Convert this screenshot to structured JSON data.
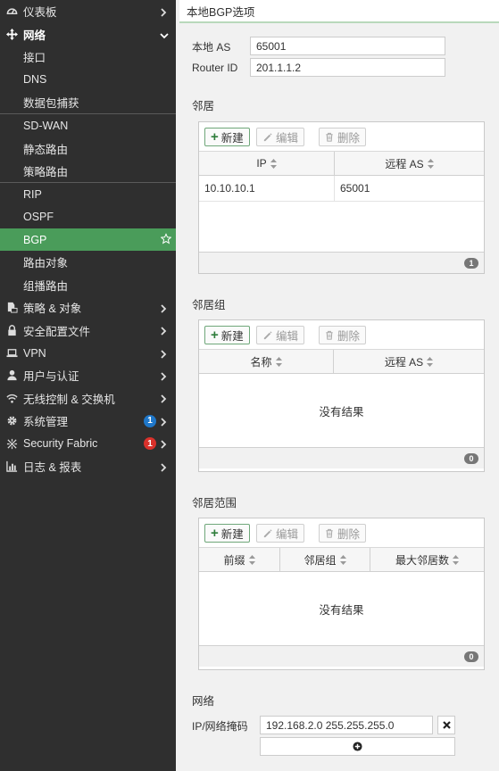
{
  "sidebar": {
    "items": [
      {
        "label": "仪表板",
        "icon": "dashboard-icon",
        "type": "top"
      },
      {
        "label": "网络",
        "icon": "network-icon",
        "type": "top-open"
      },
      {
        "label": "接口",
        "type": "sub"
      },
      {
        "label": "DNS",
        "type": "sub"
      },
      {
        "label": "数据包捕获",
        "type": "sub"
      },
      {
        "label": "SD-WAN",
        "type": "sub"
      },
      {
        "label": "静态路由",
        "type": "sub"
      },
      {
        "label": "策略路由",
        "type": "sub"
      },
      {
        "label": "RIP",
        "type": "sub"
      },
      {
        "label": "OSPF",
        "type": "sub"
      },
      {
        "label": "BGP",
        "type": "active"
      },
      {
        "label": "路由对象",
        "type": "sub"
      },
      {
        "label": "组播路由",
        "type": "sub"
      },
      {
        "label": "策略 & 对象",
        "icon": "policy-icon",
        "type": "top"
      },
      {
        "label": "安全配置文件",
        "icon": "lock-icon",
        "type": "top"
      },
      {
        "label": "VPN",
        "icon": "laptop-icon",
        "type": "top"
      },
      {
        "label": "用户与认证",
        "icon": "user-icon",
        "type": "top"
      },
      {
        "label": "无线控制 & 交换机",
        "icon": "wifi-icon",
        "type": "top"
      },
      {
        "label": "系统管理",
        "icon": "gear-icon",
        "type": "top",
        "badge": "1",
        "badge_color": "#1f77c9"
      },
      {
        "label": "Security Fabric",
        "icon": "fabric-icon",
        "type": "top",
        "badge": "1",
        "badge_color": "#d9312b"
      },
      {
        "label": "日志 & 报表",
        "icon": "chart-icon",
        "type": "top"
      }
    ]
  },
  "main": {
    "title": "本地BGP选项",
    "local_as_label": "本地 AS",
    "local_as_value": "65001",
    "router_id_label": "Router ID",
    "router_id_value": "201.1.1.2",
    "neighbors": {
      "title": "邻居",
      "new_btn": "新建",
      "edit_btn": "编辑",
      "delete_btn": "删除",
      "columns": [
        "IP",
        "远程 AS"
      ],
      "rows": [
        [
          "10.10.10.1",
          "65001"
        ]
      ],
      "count": "1"
    },
    "neighbor_groups": {
      "title": "邻居组",
      "new_btn": "新建",
      "edit_btn": "编辑",
      "delete_btn": "删除",
      "columns": [
        "名称",
        "远程 AS"
      ],
      "empty": "没有结果",
      "count": "0"
    },
    "neighbor_ranges": {
      "title": "邻居范围",
      "new_btn": "新建",
      "edit_btn": "编辑",
      "delete_btn": "删除",
      "columns": [
        "前缀",
        "邻居组",
        "最大邻居数"
      ],
      "empty": "没有结果",
      "count": "0"
    },
    "network": {
      "title": "网络",
      "ip_mask_label": "IP/网络掩码",
      "ip_mask_value": "192.168.2.0 255.255.255.0"
    }
  },
  "colors": {
    "sidebar_bg": "#2f2f2f",
    "active_bg": "#4a9c5a",
    "accent_green": "#2e7d3b"
  }
}
